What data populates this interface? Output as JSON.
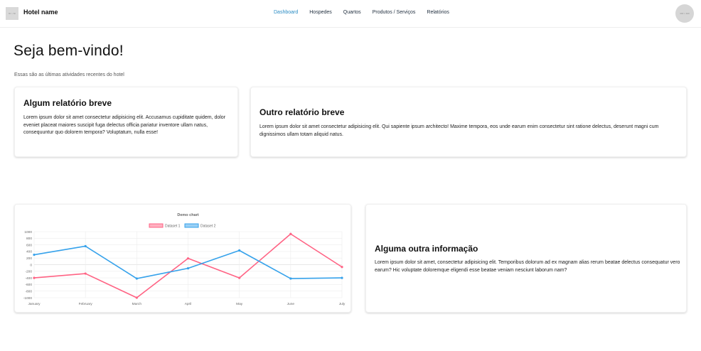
{
  "navbar": {
    "logo_text": "80 × 80",
    "brand": "Hotel name",
    "links": [
      {
        "label": "Dashboard",
        "active": true
      },
      {
        "label": "Hospedes",
        "active": false
      },
      {
        "label": "Quartos",
        "active": false
      },
      {
        "label": "Produtos / Serviços",
        "active": false
      },
      {
        "label": "Relatórios",
        "active": false
      }
    ],
    "avatar_text": "400 × 400"
  },
  "main": {
    "title": "Seja bem-vindo!",
    "subtitle": "Essas são as últimas atividades recentes do hotel"
  },
  "cards": {
    "card1": {
      "title": "Algum relatório breve",
      "text": "Lorem ipsum dolor sit amet consectetur adipisicing elit. Accusamus cupiditate quidem, dolor eveniet placeat maiores suscipit fuga delectus officia pariatur inventore ullam natus, consequuntur quo dolorem tempora? Voluptatum, nulla esse!"
    },
    "card2": {
      "title": "Outro relatório breve",
      "text": "Lorem ipsum dolor sit amet consectetur adipisicing elit. Qui sapiente ipsum architecto! Maxime tempora, eos unde earum enim consectetur sint ratione delectus, deserunt magni cum dignissimos ullam totam aliquid natus."
    },
    "card3": {
      "title": "Alguma outra informação",
      "text": "Lorem ipsum dolor sit amet, consectetur adipisicing elit. Temporibus dolorum ad ex magnam alias rerum beatae delectus consequatur vero earum? Hic voluptate doloremque eligendi esse beatae veniam nesciunt laborum nam?"
    }
  },
  "colors": {
    "accent": "#2b8cc4",
    "dataset1": "#ff6384",
    "dataset2": "#36a2eb"
  },
  "chart_data": {
    "type": "line",
    "title": "Demo chart",
    "categories": [
      "January",
      "February",
      "March",
      "April",
      "May",
      "June",
      "July"
    ],
    "series": [
      {
        "name": "Dataset 1",
        "color": "#ff6384",
        "values": [
          -400,
          -270,
          -1000,
          190,
          -400,
          930,
          -70
        ]
      },
      {
        "name": "Dataset 2",
        "color": "#36a2eb",
        "values": [
          300,
          560,
          -420,
          -110,
          430,
          -420,
          -400
        ]
      }
    ],
    "ylim": [
      -1000,
      1000
    ],
    "yticks": [
      "1000",
      "800",
      "600",
      "400",
      "200",
      "0",
      "-200",
      "-400",
      "-600",
      "-800",
      "-1000"
    ],
    "legend": "top",
    "grid": true
  }
}
